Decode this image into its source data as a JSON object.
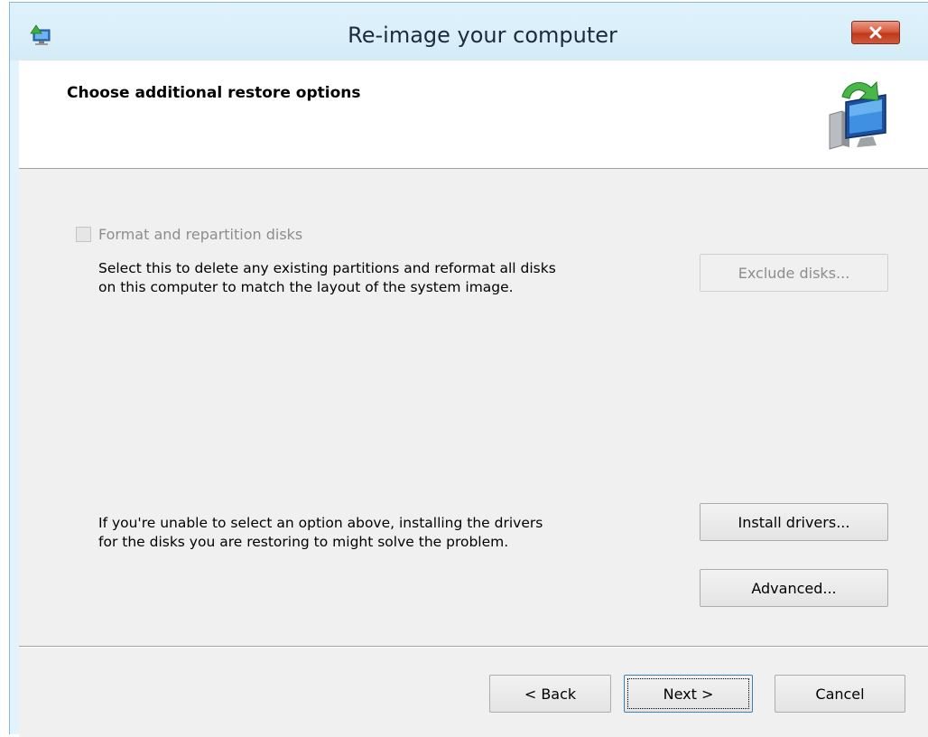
{
  "window": {
    "title": "Re-image your computer",
    "icons": {
      "app": "restore-app-icon",
      "close": "close-icon",
      "header": "computer-restore-icon"
    }
  },
  "header": {
    "title": "Choose additional restore options"
  },
  "format_option": {
    "label": "Format and repartition disks",
    "checked": false,
    "enabled": false,
    "description_line1": "Select this to delete any existing partitions and reformat all disks",
    "description_line2": "on this computer to match the layout of the system image."
  },
  "buttons": {
    "exclude": "Exclude disks...",
    "install_drivers": "Install drivers...",
    "advanced": "Advanced...",
    "back": "< Back",
    "next": "Next >",
    "cancel": "Cancel"
  },
  "drivers_hint": {
    "line1": "If you're unable to select an option above, installing the drivers",
    "line2": "for the disks you are restoring to might solve the problem."
  },
  "colors": {
    "title_bar": "#dff2fb",
    "close_button": "#c7401f",
    "client_background": "#f0f0f0",
    "disabled_text": "#8d8d8d"
  }
}
